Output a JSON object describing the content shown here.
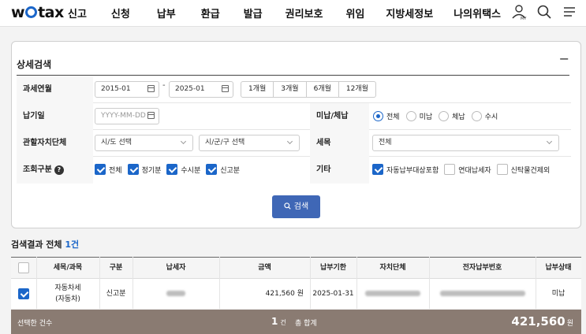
{
  "header": {
    "logo_left": "w",
    "logo_right": "tax",
    "nav": [
      "신고",
      "신청",
      "납부",
      "환급",
      "발급",
      "권리보호",
      "위임",
      "지방세정보",
      "나의위택스"
    ],
    "icon_my": "MY"
  },
  "search": {
    "title": "상세검색",
    "collapse": "−",
    "period_label": "과세연월",
    "period_from": "2015-01",
    "period_sep": "-",
    "period_to": "2025-01",
    "period_buttons": [
      "1개월",
      "3개월",
      "6개월",
      "12개월"
    ],
    "due_label": "납기일",
    "due_placeholder": "YYYY-MM-DD",
    "unpaid_label": "미납/체납",
    "unpaid_options": [
      "전체",
      "미납",
      "체납",
      "수시"
    ],
    "region_label": "관할자치단체",
    "region_sido": "시/도 선택",
    "region_sigungu": "시/군/구 선택",
    "tax_label": "세목",
    "tax_value": "전체",
    "type_label": "조회구분",
    "help": "?",
    "type_options": [
      "전체",
      "정기분",
      "수시분",
      "신고분"
    ],
    "etc_label": "기타",
    "etc_options": [
      "자동납부대상포함",
      "연대납세자",
      "신탁물건제외"
    ],
    "button": "검색"
  },
  "results": {
    "prefix": "검색결과 전체 ",
    "count": "1건",
    "columns": [
      "세목/과목",
      "구분",
      "납세자",
      "금액",
      "납부기한",
      "자치단체",
      "전자납부번호",
      "납부상태"
    ],
    "row": {
      "tax_line1": "자동차세",
      "tax_line2": "(자동차)",
      "kind": "신고분",
      "amount": "421,560 원",
      "due": "2025-01-31",
      "status": "미납"
    }
  },
  "footer": {
    "selected_label": "선택한 건수",
    "selected_count": "1",
    "selected_unit": "건",
    "total_label": "총 합계",
    "total_amount": "421,560",
    "total_unit": "원"
  },
  "colors": {
    "accent": "#1b66c9",
    "button": "#3f67b6",
    "footer": "#8a7b72"
  }
}
